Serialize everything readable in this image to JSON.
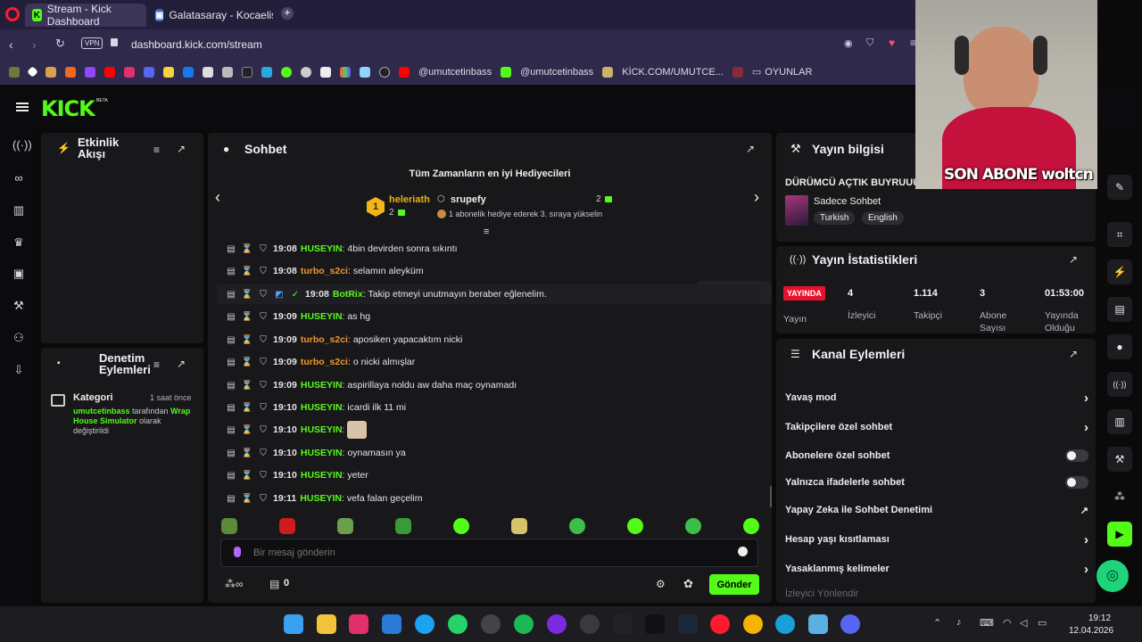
{
  "browser": {
    "tabs": [
      {
        "label": "Stream - Kick Dashboard",
        "active": true
      },
      {
        "label": "Galatasaray - Kocaelispor",
        "active": false
      }
    ],
    "url": "dashboard.kick.com/stream",
    "vpn_label": "VPN",
    "bookmarks": [
      "@umutcetinbass",
      "@umutcetinbass",
      "KİCK.COM/UMUTCE...",
      "OYUNLAR"
    ]
  },
  "brand": {
    "logo": "KICK",
    "badge": "BETA"
  },
  "activity": {
    "title_line1": "Etkinlik",
    "title_line2": "Akışı"
  },
  "moderation": {
    "title_line1": "Denetim",
    "title_line2": "Eylemleri",
    "entry": {
      "label": "Kategori",
      "time": "1 saat önce",
      "user": "umutcetinbass",
      "by": "tarafından",
      "category": "Wrap House Simulator",
      "olarak": "olarak",
      "changed": "değiştirildi"
    }
  },
  "chat": {
    "title": "Sohbet",
    "gifters_title": "Tüm Zamanların en iyi Hediyecileri",
    "gifter1": {
      "rank": "1",
      "name": "heleriath",
      "count": "2"
    },
    "gifter2": {
      "name": "srupefy",
      "count": "2",
      "hint": "1 abonelik hediye ederek 3. sıraya yükselin"
    },
    "messages": [
      {
        "time": "19:08",
        "user": "HUSEYIN",
        "color": "green",
        "text": "4bin devirden sonra sıkıntı"
      },
      {
        "time": "19:08",
        "user": "turbo_s2ci",
        "color": "orange",
        "text": "selamın aleyküm"
      },
      {
        "time": "19:08",
        "user": "BotRix",
        "color": "green",
        "text": "Takip etmeyi unutmayın beraber eğlenelim."
      },
      {
        "time": "19:09",
        "user": "HUSEYIN",
        "color": "green",
        "text": "as hg"
      },
      {
        "time": "19:09",
        "user": "turbo_s2ci",
        "color": "orange",
        "text": "aposiken yapacaktım nicki"
      },
      {
        "time": "19:09",
        "user": "turbo_s2ci",
        "color": "orange",
        "text": "o nicki almışlar"
      },
      {
        "time": "19:09",
        "user": "HUSEYIN",
        "color": "green",
        "text": "aspirillaya noldu aw daha maç oynamadı"
      },
      {
        "time": "19:10",
        "user": "HUSEYIN",
        "color": "green",
        "text": "icardi ilk 11 mi"
      },
      {
        "time": "19:10",
        "user": "HUSEYIN",
        "color": "green",
        "text": ""
      },
      {
        "time": "19:10",
        "user": "HUSEYIN",
        "color": "green",
        "text": "oynamasın ya"
      },
      {
        "time": "19:10",
        "user": "HUSEYIN",
        "color": "green",
        "text": "yeter"
      },
      {
        "time": "19:11",
        "user": "HUSEYIN",
        "color": "green",
        "text": "vefa falan geçelim"
      }
    ],
    "input_placeholder": "Bir mesaj gönderin",
    "counter": "0",
    "send_label": "Gönder"
  },
  "stream_info": {
    "title": "Yayın bilgisi",
    "stream_title": "DÜRÜMCÜ AÇTIK BUYRUUUN",
    "category": "Sadece Sohbet",
    "tags": [
      "Turkish",
      "English"
    ],
    "overlay_text": "SON ABONE woltcn"
  },
  "stats": {
    "title": "Yayın İstatistikleri",
    "live_badge": "YAYINDA",
    "items": [
      {
        "value": "",
        "label": "Yayın"
      },
      {
        "value": "4",
        "label": "İzleyici"
      },
      {
        "value": "1.114",
        "label": "Takipçi"
      },
      {
        "value": "3",
        "label": "Abone Sayısı"
      },
      {
        "value": "01:53:00",
        "label": "Yayında Olduğu"
      }
    ]
  },
  "actions": {
    "title": "Kanal Eylemleri",
    "items": [
      {
        "label": "Yavaş mod",
        "kind": "chevron"
      },
      {
        "label": "Takipçilere özel sohbet",
        "kind": "chevron"
      },
      {
        "label": "Abonelere özel sohbet",
        "kind": "toggle"
      },
      {
        "label": "Yalnızca ifadelerle sohbet",
        "kind": "toggle"
      },
      {
        "label": "Yapay Zeka ile Sohbet Denetimi",
        "kind": "external"
      },
      {
        "label": "Hesap yaşı kısıtlaması",
        "kind": "chevron"
      },
      {
        "label": "Yasaklanmış kelimeler",
        "kind": "chevron"
      },
      {
        "label": "İzleyici Yönlendir",
        "kind": "none"
      }
    ]
  },
  "taskbar": {
    "time": "19:12",
    "date": "12.04.2026"
  },
  "colors": {
    "kick_green": "#53fc18",
    "panel": "#18181b",
    "live_red": "#e8112d",
    "orange": "#f0972b"
  }
}
